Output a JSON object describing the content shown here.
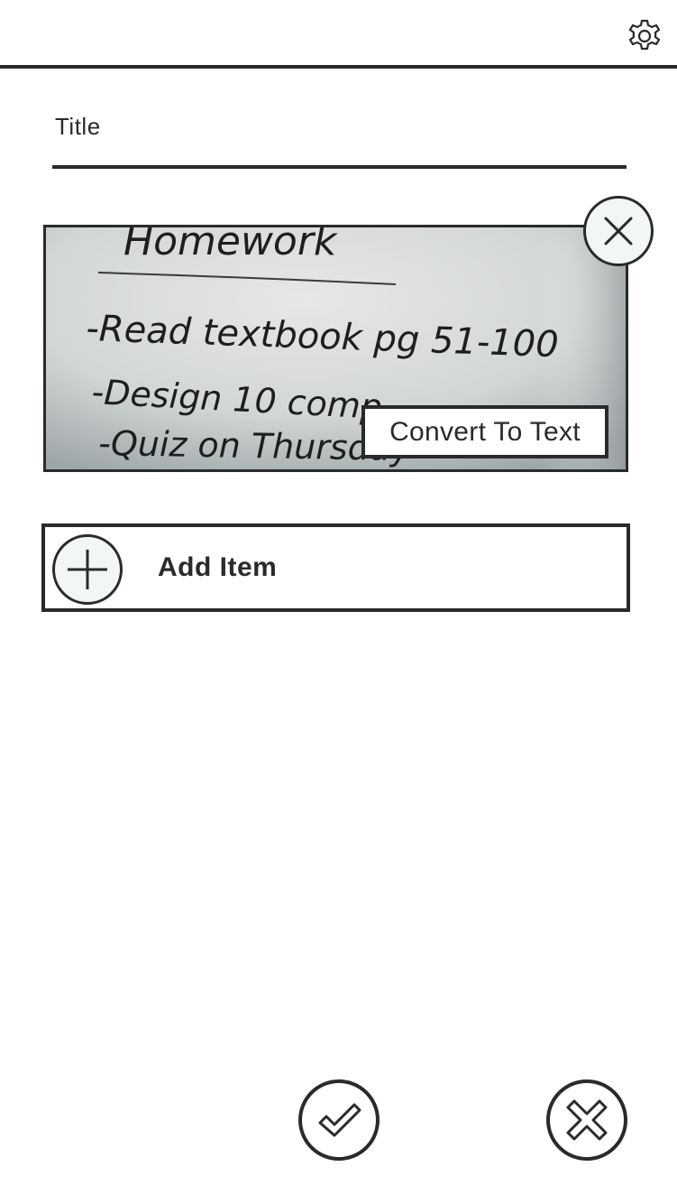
{
  "header": {
    "settings_icon": "gear-icon"
  },
  "form": {
    "title_label": "Title"
  },
  "photo": {
    "description_icon": "handwritten-note-photo",
    "remove_icon": "close-icon",
    "convert_label": "Convert To Text",
    "handwriting": {
      "line0": "Homework",
      "line1": "-Read textbook pg 51-100",
      "line2": "-Design 10 comp",
      "line3": "-Quiz on Thursday"
    }
  },
  "add_item": {
    "icon": "plus-icon",
    "label": "Add Item"
  },
  "footer": {
    "confirm_icon": "checkmark-icon",
    "cancel_icon": "close-icon"
  },
  "colors": {
    "ink": "#2a2a2a",
    "icon_fill": "#f2f6f6",
    "whiteboard": "#d9dcda"
  }
}
